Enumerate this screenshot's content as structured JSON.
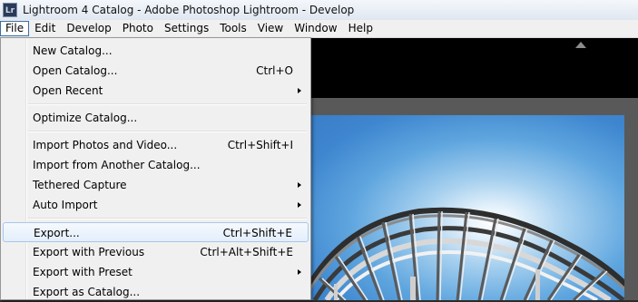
{
  "window": {
    "icon_text": "Lr",
    "title": "Lightroom 4 Catalog - Adobe Photoshop Lightroom - Develop"
  },
  "menubar": {
    "items": [
      "File",
      "Edit",
      "Develop",
      "Photo",
      "Settings",
      "Tools",
      "View",
      "Window",
      "Help"
    ],
    "active": "File"
  },
  "file_menu": {
    "groups": [
      [
        {
          "label": "New Catalog...",
          "shortcut": "",
          "submenu": false
        },
        {
          "label": "Open Catalog...",
          "shortcut": "Ctrl+O",
          "submenu": false
        },
        {
          "label": "Open Recent",
          "shortcut": "",
          "submenu": true
        }
      ],
      [
        {
          "label": "Optimize Catalog...",
          "shortcut": "",
          "submenu": false
        }
      ],
      [
        {
          "label": "Import Photos and Video...",
          "shortcut": "Ctrl+Shift+I",
          "submenu": false
        },
        {
          "label": "Import from Another Catalog...",
          "shortcut": "",
          "submenu": false
        },
        {
          "label": "Tethered Capture",
          "shortcut": "",
          "submenu": true
        },
        {
          "label": "Auto Import",
          "shortcut": "",
          "submenu": true
        }
      ],
      [
        {
          "label": "Export...",
          "shortcut": "Ctrl+Shift+E",
          "submenu": false,
          "highlighted": true
        },
        {
          "label": "Export with Previous",
          "shortcut": "Ctrl+Alt+Shift+E",
          "submenu": false
        },
        {
          "label": "Export with Preset",
          "shortcut": "",
          "submenu": true
        },
        {
          "label": "Export as Catalog...",
          "shortcut": "",
          "submenu": false
        }
      ]
    ]
  }
}
